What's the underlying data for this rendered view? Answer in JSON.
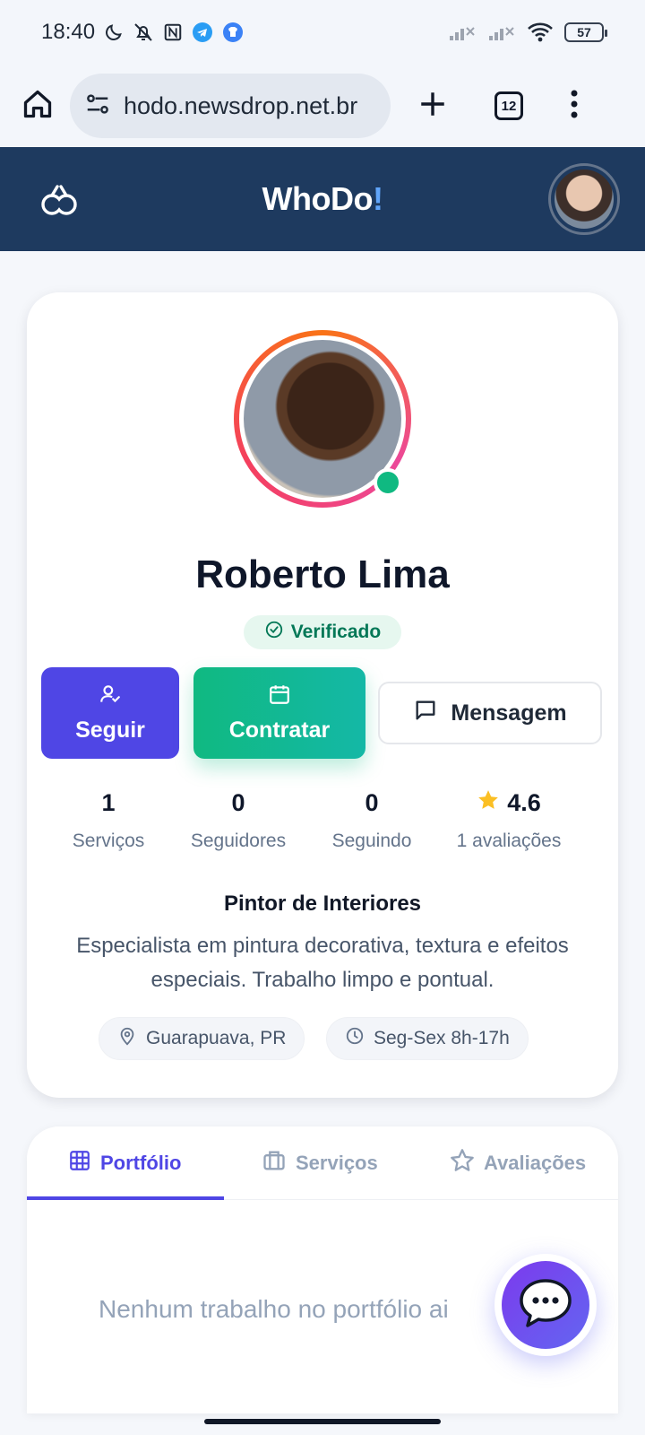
{
  "status_bar": {
    "time": "18:40",
    "battery": "57",
    "icons": [
      "moon-icon",
      "bell-off-icon",
      "nfc-icon",
      "telegram-icon",
      "shirt-app-icon",
      "signal-icon",
      "signal-icon",
      "wifi-icon"
    ]
  },
  "browser": {
    "url": "hodo.newsdrop.net.br",
    "tab_count": "12"
  },
  "app": {
    "title_main": "WhoDo",
    "title_accent": "!",
    "accent_color": "#60a5fa",
    "header_color": "#1e3a5f"
  },
  "profile": {
    "name": "Roberto Lima",
    "verified_label": "Verificado",
    "online": true,
    "actions": {
      "follow_label": "Seguir",
      "hire_label": "Contratar",
      "message_label": "Mensagem"
    },
    "stats": [
      {
        "value": "1",
        "label": "Serviços"
      },
      {
        "value": "0",
        "label": "Seguidores"
      },
      {
        "value": "0",
        "label": "Seguindo"
      },
      {
        "value": "4.6",
        "label": "1 avaliações"
      }
    ],
    "profession": "Pintor de Interiores",
    "bio": "Especialista em pintura decorativa, textura e efeitos especiais. Trabalho limpo e pontual.",
    "location": "Guarapuava, PR",
    "hours": "Seg-Sex 8h-17h"
  },
  "tabs": {
    "items": [
      {
        "label": "Portfólio",
        "icon": "grid-icon",
        "active": true
      },
      {
        "label": "Serviços",
        "icon": "briefcase-icon",
        "active": false
      },
      {
        "label": "Avaliações",
        "icon": "star-icon",
        "active": false
      }
    ],
    "empty_message": "Nenhum trabalho no portfólio ai"
  },
  "colors": {
    "primary": "#4f46e5",
    "success": "#10b981",
    "star": "#fbbf24"
  }
}
